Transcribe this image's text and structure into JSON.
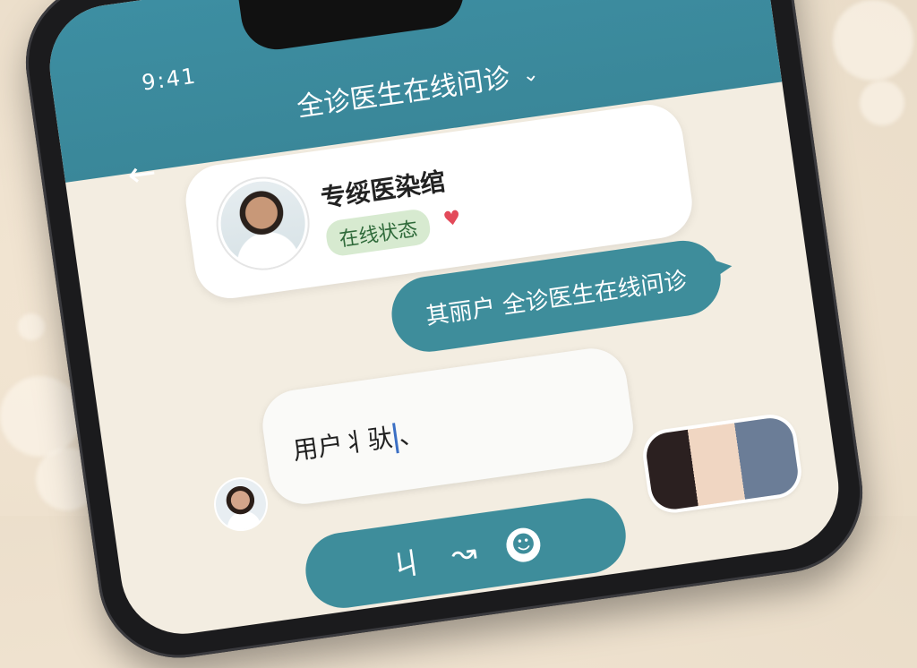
{
  "status_bar": {
    "time": "9:41"
  },
  "header": {
    "title": "全诊医生在线问诊",
    "dropdown_icon": "chevron-down-icon",
    "back_icon": "back-arrow-icon"
  },
  "doctor_card": {
    "name": "专绥医染绾",
    "status": "在线状态",
    "status_icon": "heart-icon"
  },
  "messages": {
    "outgoing": "其丽户 全诊医生在线问诊",
    "incoming_before_cursor": "用户丬驮",
    "incoming_after_cursor": "、"
  },
  "input_bar": {
    "icon1": "ㄐ",
    "icon2": "↝",
    "icon3": "☻"
  },
  "colors": {
    "accent": "#3e8d9b",
    "status_bg": "#d7ead0",
    "heart": "#e34a5a"
  }
}
